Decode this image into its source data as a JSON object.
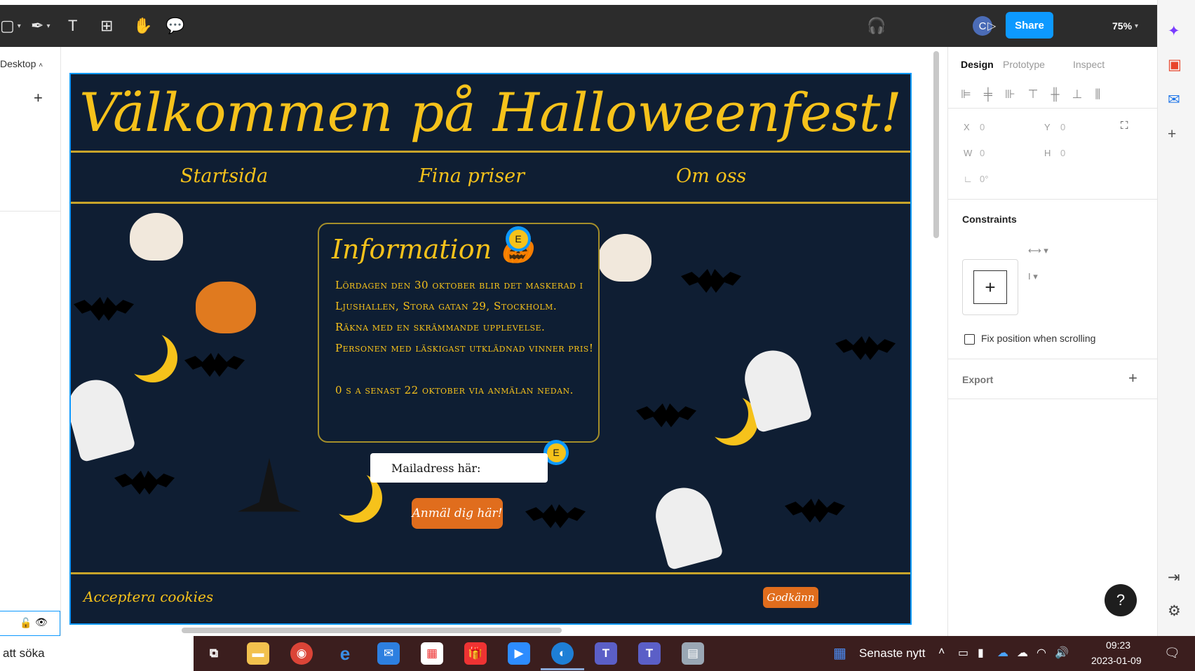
{
  "toolbar": {
    "zoom": "75%",
    "share_label": "Share",
    "avatar_initial": "C"
  },
  "left_panel": {
    "page_label": "Desktop"
  },
  "site": {
    "title": "Välkommen på Halloweenfest!",
    "nav": [
      "Startsida",
      "Fina priser",
      "Om oss"
    ],
    "info": {
      "title": "Information 🎃",
      "text": "Lördagen den 30 oktober blir det maskerad i Ljushallen, Stora gatan 29, Stockholm.\nRäkna med en skrämmande upplevelse.\nPersonen med läskigast utklädnad vinner pris!\n\n0 s a senast 22 oktober via anmälan nedan."
    },
    "email_placeholder": "Mailadress här:",
    "signup_label": "Anmäl dig här!",
    "cookie_text": "Acceptera cookies",
    "cookie_button": "Godkänn"
  },
  "comments": [
    "E",
    "E"
  ],
  "right_panel": {
    "tabs": [
      "Design",
      "Prototype",
      "Inspect"
    ],
    "x_label": "X",
    "x_value": "0",
    "y_label": "Y",
    "y_value": "0",
    "w_label": "W",
    "w_value": "0",
    "h_label": "H",
    "h_value": "0",
    "rotation_value": "0°",
    "constraints_title": "Constraints",
    "fix_position_label": "Fix position when scrolling",
    "export_title": "Export"
  },
  "help_label": "?",
  "taskbar": {
    "search_text": "att söka",
    "news_label": "Senaste nytt",
    "time": "09:23",
    "date": "2023-01-09"
  },
  "colors": {
    "site_background": "#0f1e33",
    "site_accent": "#f6c21b",
    "button_orange": "#e06d1d",
    "figma_blue": "#0d99ff"
  }
}
